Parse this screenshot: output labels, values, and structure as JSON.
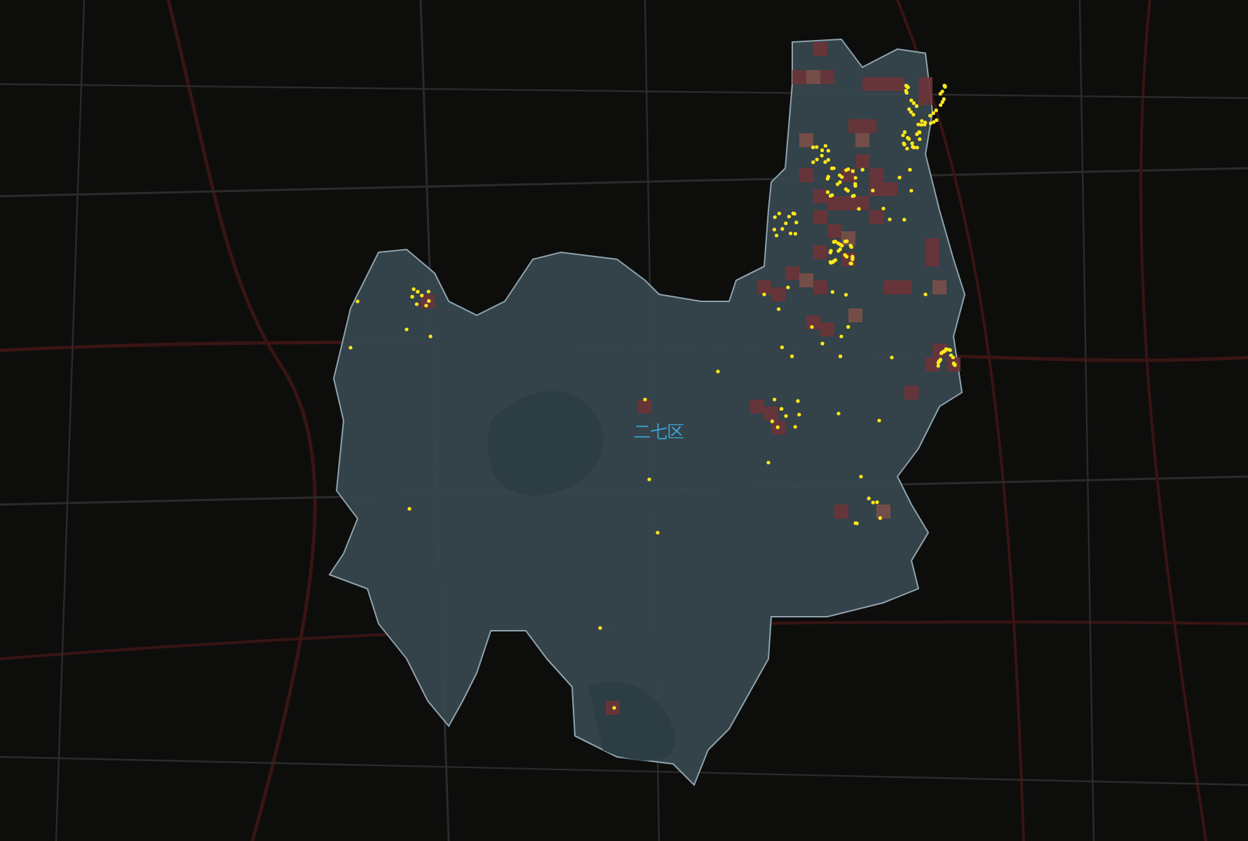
{
  "map": {
    "district_label": "二七区"
  }
}
